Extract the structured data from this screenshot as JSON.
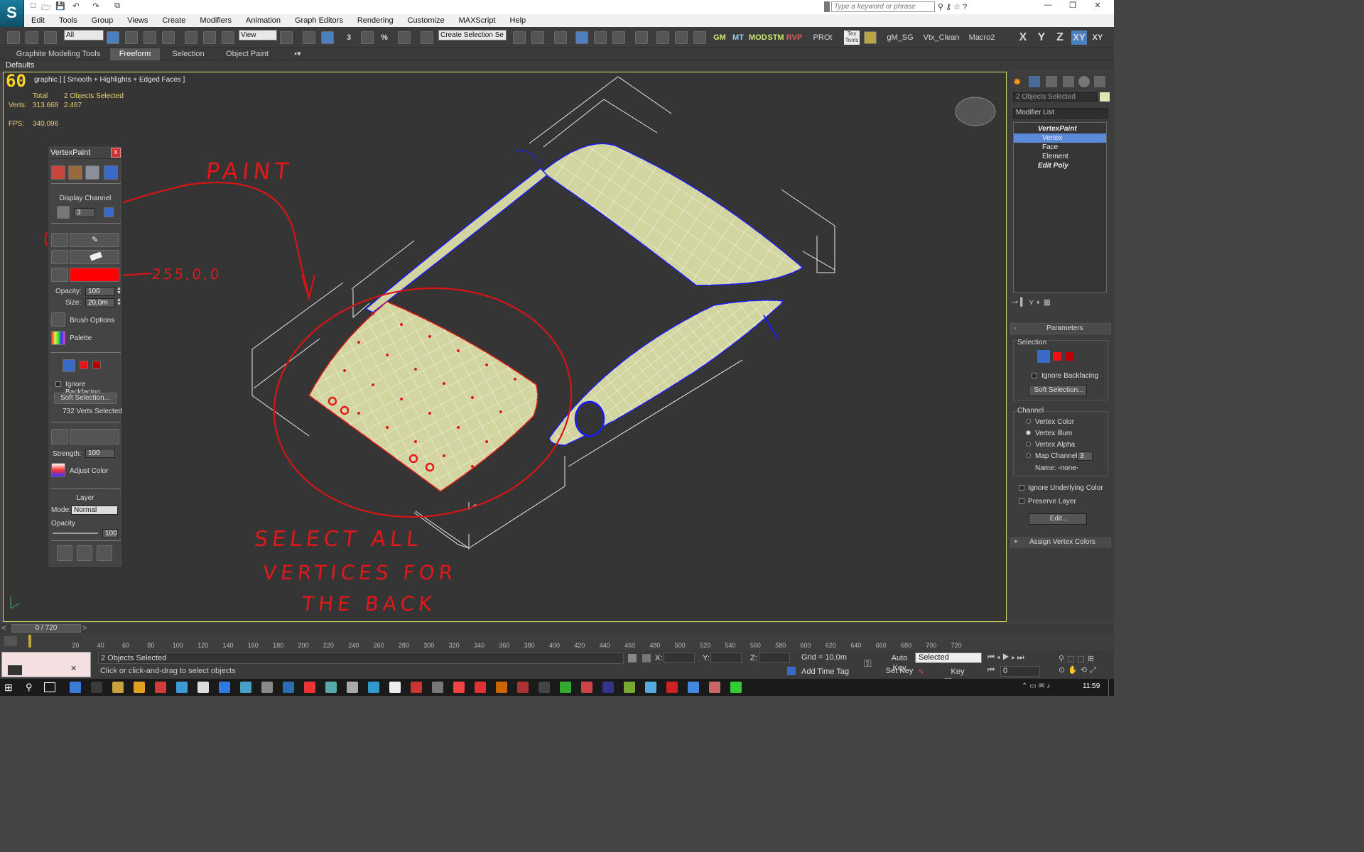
{
  "app": {
    "logo_glyph": "S",
    "search_placeholder": "Type a keyword or phrase",
    "quick_access_glyphs": [
      "□",
      "🗁",
      "💾",
      "↶",
      "↷",
      "⧉"
    ]
  },
  "menu": {
    "items": [
      "Edit",
      "Tools",
      "Group",
      "Views",
      "Create",
      "Modifiers",
      "Animation",
      "Graph Editors",
      "Rendering",
      "Customize",
      "MAXScript",
      "Help"
    ]
  },
  "window_controls": {
    "minimize": "—",
    "restore": "❐",
    "close": "✕"
  },
  "toolbar": {
    "selection_filter": "All",
    "ref_coord": "View",
    "named_selection": "Create Selection Se",
    "snap_labels": [
      "3",
      "%"
    ],
    "script_labels": [
      "GM",
      "MT",
      "MOD",
      "STM",
      "RVP"
    ],
    "extra_labels": [
      "PROt",
      "Tex Tools",
      "gM_SG",
      "Vtx_Clean",
      "Macro2"
    ],
    "axes": [
      "X",
      "Y",
      "Z",
      "XY",
      "XY"
    ]
  },
  "ribbon": {
    "tabs": [
      "Graphite Modeling Tools",
      "Freeform",
      "Selection",
      "Object Paint"
    ],
    "active": "Freeform",
    "defaults_label": "Defaults"
  },
  "viewport": {
    "label": "[ + ] [ Orthographic ] [ Smooth + Highlights + Edged Faces ]",
    "label_visible": "graphic ] [ Smooth + Highlights + Edged Faces ]",
    "fps_overlay": "60",
    "stats": {
      "total_label": "Total",
      "selected_label": "2 Objects Selected",
      "verts_label": "Verts:",
      "verts_total": "313.668",
      "verts_selected": "2.467",
      "fps_label": "FPS:",
      "fps_value": "340,096"
    },
    "annotations": {
      "paint": "PAINT",
      "color": "255,0,0",
      "select1": "SELECT ALL",
      "select2": "VERTICES FOR",
      "select3": "THE BACK"
    }
  },
  "vertexpaint": {
    "title": "VertexPaint",
    "close": "x",
    "display_channel": "Display Channel",
    "channel_value": "3",
    "paint_color": "#ff0000",
    "opacity_label": "Opacity:",
    "opacity_value": "100",
    "size_label": "Size:",
    "size_value": "20,0m",
    "brush_options": "Brush Options",
    "palette": "Palette",
    "ignore_backfacing": "Ignore Backfacing",
    "soft_selection": "Soft Selection...",
    "verts_selected": "732 Verts Selected",
    "strength_label": "Strength:",
    "strength_value": "100",
    "adjust_color": "Adjust Color",
    "layer": "Layer",
    "mode_label": "Mode:",
    "mode_value": "Normal",
    "layer_opacity": "Opacity",
    "layer_opacity_value": "100"
  },
  "command_panel": {
    "object_name": "2 Objects Selected",
    "modifier_list": "Modifier List",
    "stack": [
      {
        "label": "VertexPaint",
        "level": 0,
        "selected": false,
        "bold": true
      },
      {
        "label": "Vertex",
        "level": 1,
        "selected": true,
        "bold": false
      },
      {
        "label": "Face",
        "level": 1,
        "selected": false,
        "bold": false
      },
      {
        "label": "Element",
        "level": 1,
        "selected": false,
        "bold": false
      },
      {
        "label": "Edit Poly",
        "level": 0,
        "selected": false,
        "bold": true
      }
    ],
    "parameters": "Parameters",
    "selection": "Selection",
    "ignore_backfacing": "Ignore Backfacing",
    "soft_selection": "Soft Selection...",
    "channel": "Channel",
    "channel_options": [
      "Vertex Color",
      "Vertex Illum",
      "Vertex Alpha",
      "Map Channel"
    ],
    "channel_selected": "Vertex Illum",
    "map_channel_value": "3",
    "name_label": "Name: -none-",
    "ignore_underlying": "Ignore Underlying Color",
    "preserve_layer": "Preserve Layer",
    "edit_button": "Edit...",
    "assign": "Assign Vertex Colors",
    "collapse_minus": "-",
    "expand_plus": "+"
  },
  "timeline": {
    "frame_display": "0 / 720",
    "prev_arrow": "<",
    "next_arrow": ">",
    "ticks": [
      "20",
      "40",
      "60",
      "80",
      "100",
      "120",
      "140",
      "160",
      "180",
      "200",
      "220",
      "240",
      "260",
      "280",
      "300",
      "320",
      "340",
      "360",
      "380",
      "400",
      "420",
      "440",
      "460",
      "480",
      "500",
      "520",
      "540",
      "560",
      "580",
      "600",
      "620",
      "640",
      "660",
      "680",
      "700",
      "720"
    ]
  },
  "status": {
    "selected": "2 Objects Selected",
    "prompt": "Click or click-and-drag to select objects",
    "x_label": "X:",
    "y_label": "Y:",
    "z_label": "Z:",
    "grid": "Grid = 10,0m",
    "add_time_tag": "Add Time Tag",
    "auto_key": "Auto Key",
    "set_key": "Set Key",
    "key_mode": "Selected",
    "key_filters": "Key Filters...",
    "frame": "0"
  },
  "taskbar": {
    "clock": "11:59",
    "colors": [
      "#3a7bd5",
      "#3a3a3a",
      "#c8a040",
      "#e0a020",
      "#d23b3b",
      "#3b9bd2",
      "#ddd",
      "#2c7be0",
      "#4aa0c8",
      "#888",
      "#2d6bb4",
      "#e33",
      "#5aa",
      "#aaa",
      "#39c",
      "#eee",
      "#c33",
      "#777",
      "#e44",
      "#d33",
      "#c60",
      "#a33",
      "#444",
      "#3a3",
      "#c44",
      "#338",
      "#7a3",
      "#5ad",
      "#c22",
      "#48d",
      "#c66",
      "#3c3"
    ]
  }
}
